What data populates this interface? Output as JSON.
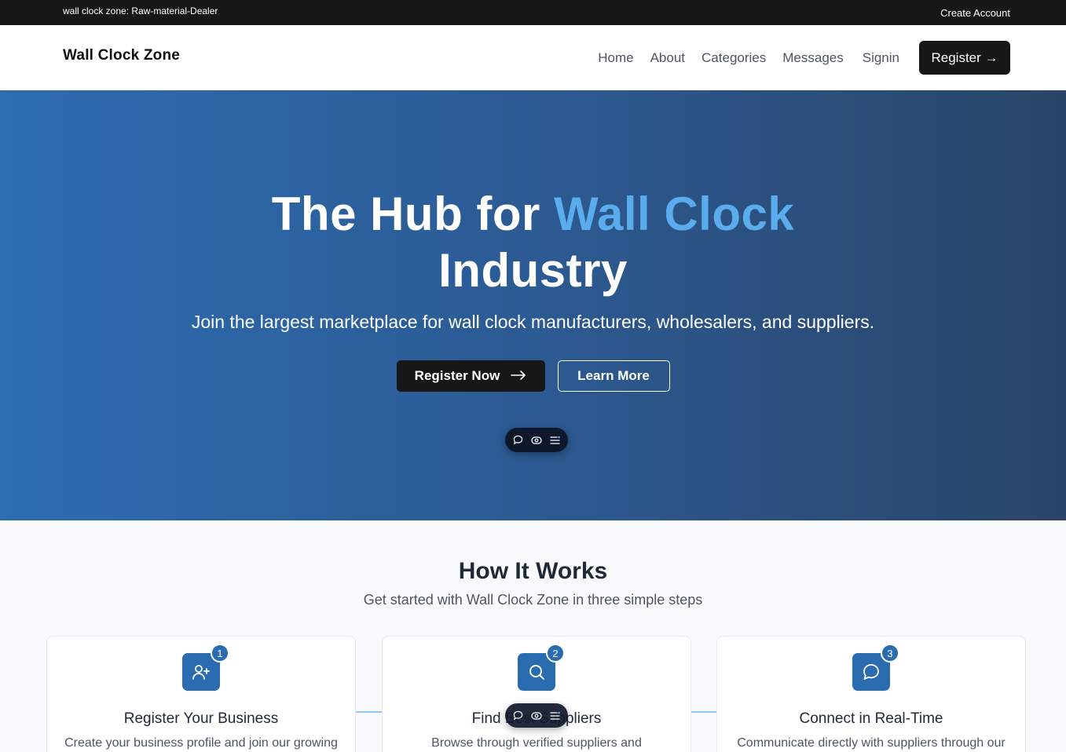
{
  "topbar": {
    "zone_label": "wall clock zone: Raw-material-Dealer",
    "create_account": "Create Account"
  },
  "navbar": {
    "brand": "Wall Clock Zone",
    "links": [
      "Home",
      "About",
      "Categories",
      "Messages"
    ],
    "signin": "Signin",
    "register": "Register →"
  },
  "hero": {
    "title_part1": "The Hub for ",
    "title_accent": "Wall Clock",
    "title_part2": "Industry",
    "subtitle": "Join the largest marketplace for wall clock manufacturers, wholesalers, and suppliers.",
    "primary_cta": "Register Now",
    "secondary_cta": "Learn More"
  },
  "how": {
    "heading": "How It Works",
    "subheading": "Get started with Wall Clock Zone in three simple steps",
    "steps": [
      {
        "number": "1",
        "icon": "user-plus-icon",
        "title": "Register Your Business",
        "desc": "Create your business profile and join our growing"
      },
      {
        "number": "2",
        "icon": "search-icon",
        "title": "Find Best Suppliers",
        "desc": "Browse through verified suppliers and"
      },
      {
        "number": "3",
        "icon": "chat-icon",
        "title": "Connect in Real-Time",
        "desc": "Communicate directly with suppliers through our"
      }
    ]
  },
  "colors": {
    "accent": "#5aacec",
    "brand_blue": "#2b6cb0",
    "dark": "#171717"
  }
}
